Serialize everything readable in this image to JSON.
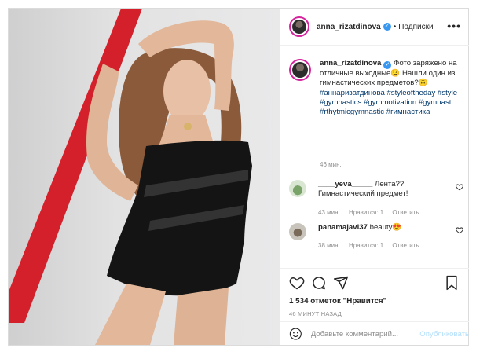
{
  "header": {
    "username": "anna_rizatdinova",
    "separator": "•",
    "follow_label": "Подписки",
    "more_label": "•••",
    "verified_mark": "✓"
  },
  "caption": {
    "username": "anna_rizatdinova",
    "text": " Фото заряжено на отличные выходные😉 Нашли один из гимнастических предметов?🙃",
    "hashtags": "#аннаризатдинова #styleoftheday #style #gymnastics #gymmotivation #gymnast #rthytmicgymnastic #гимнастика",
    "time": "46 мин."
  },
  "comments": [
    {
      "username": "____yeva_____",
      "text": " Лента?? Гимнастический предмет!",
      "time": "43 мин.",
      "likes": "Нравится: 1",
      "reply": "Ответить"
    },
    {
      "username": "panamajavi37",
      "text": " beauty😍",
      "time": "38 мин.",
      "likes": "Нравится: 1",
      "reply": "Ответить"
    }
  ],
  "actions": {
    "likes_text": "1 534 отметок \"Нравится\"",
    "time": "46 МИНУТ НАЗАД"
  },
  "add_comment": {
    "placeholder": "Добавьте комментарий...",
    "publish_label": "Опубликовать"
  },
  "colors": {
    "link": "#00376b",
    "verified": "#3897f0",
    "muted": "#8e8e8e",
    "publish_disabled": "#b2dffc",
    "ribbon": "#d3202a"
  }
}
